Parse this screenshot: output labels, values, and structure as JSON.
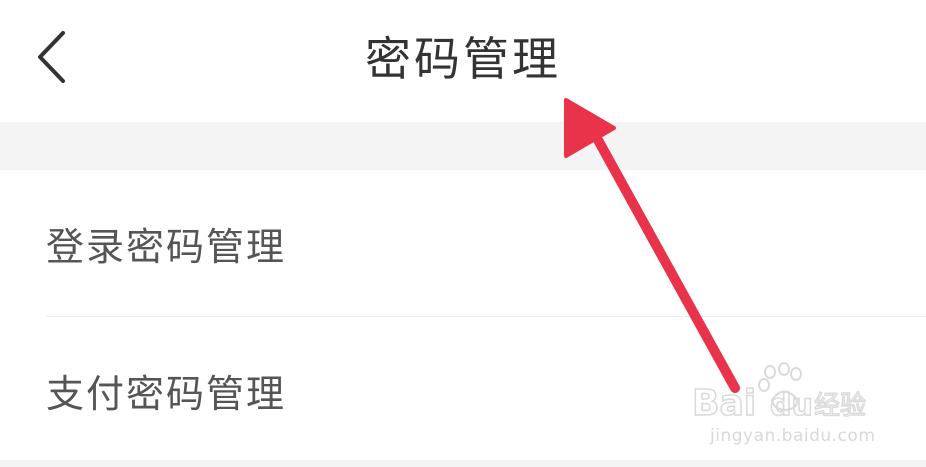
{
  "header": {
    "title": "密码管理",
    "back_icon": "chevron-left-icon"
  },
  "menu": {
    "items": [
      {
        "label": "登录密码管理"
      },
      {
        "label": "支付密码管理"
      }
    ]
  },
  "annotation": {
    "arrow_color": "#e8334a"
  },
  "watermark": {
    "brand": "Baidu经验",
    "url": "jingyan.baidu.com"
  },
  "colors": {
    "background": "#ffffff",
    "section_gap": "#f4f4f4",
    "title_text": "#333333",
    "item_text": "#555555"
  }
}
